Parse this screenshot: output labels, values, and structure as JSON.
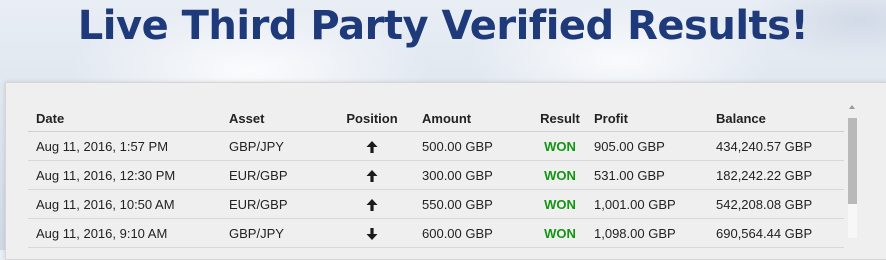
{
  "headline": "Live Third Party Verified Results!",
  "table": {
    "headers": [
      "Date",
      "Asset",
      "Position",
      "Amount",
      "Result",
      "Profit",
      "Balance"
    ],
    "rows": [
      {
        "date": "Aug 11, 2016, 1:57 PM",
        "asset": "GBP/JPY",
        "position": "up",
        "amount": "500.00 GBP",
        "result": "WON",
        "profit": "905.00 GBP",
        "balance": "434,240.57 GBP"
      },
      {
        "date": "Aug 11, 2016, 12:30 PM",
        "asset": "EUR/GBP",
        "position": "up",
        "amount": "300.00 GBP",
        "result": "WON",
        "profit": "531.00 GBP",
        "balance": "182,242.22 GBP"
      },
      {
        "date": "Aug 11, 2016, 10:50 AM",
        "asset": "EUR/GBP",
        "position": "up",
        "amount": "550.00 GBP",
        "result": "WON",
        "profit": "1,001.00 GBP",
        "balance": "542,208.08 GBP"
      },
      {
        "date": "Aug 11, 2016, 9:10 AM",
        "asset": "GBP/JPY",
        "position": "down",
        "amount": "600.00 GBP",
        "result": "WON",
        "profit": "1,098.00 GBP",
        "balance": "690,564.44 GBP"
      }
    ]
  },
  "colors": {
    "headline": "#1f3a7a",
    "won": "#119611"
  },
  "icons": {
    "up": "arrow-up-icon",
    "down": "arrow-down-icon"
  }
}
